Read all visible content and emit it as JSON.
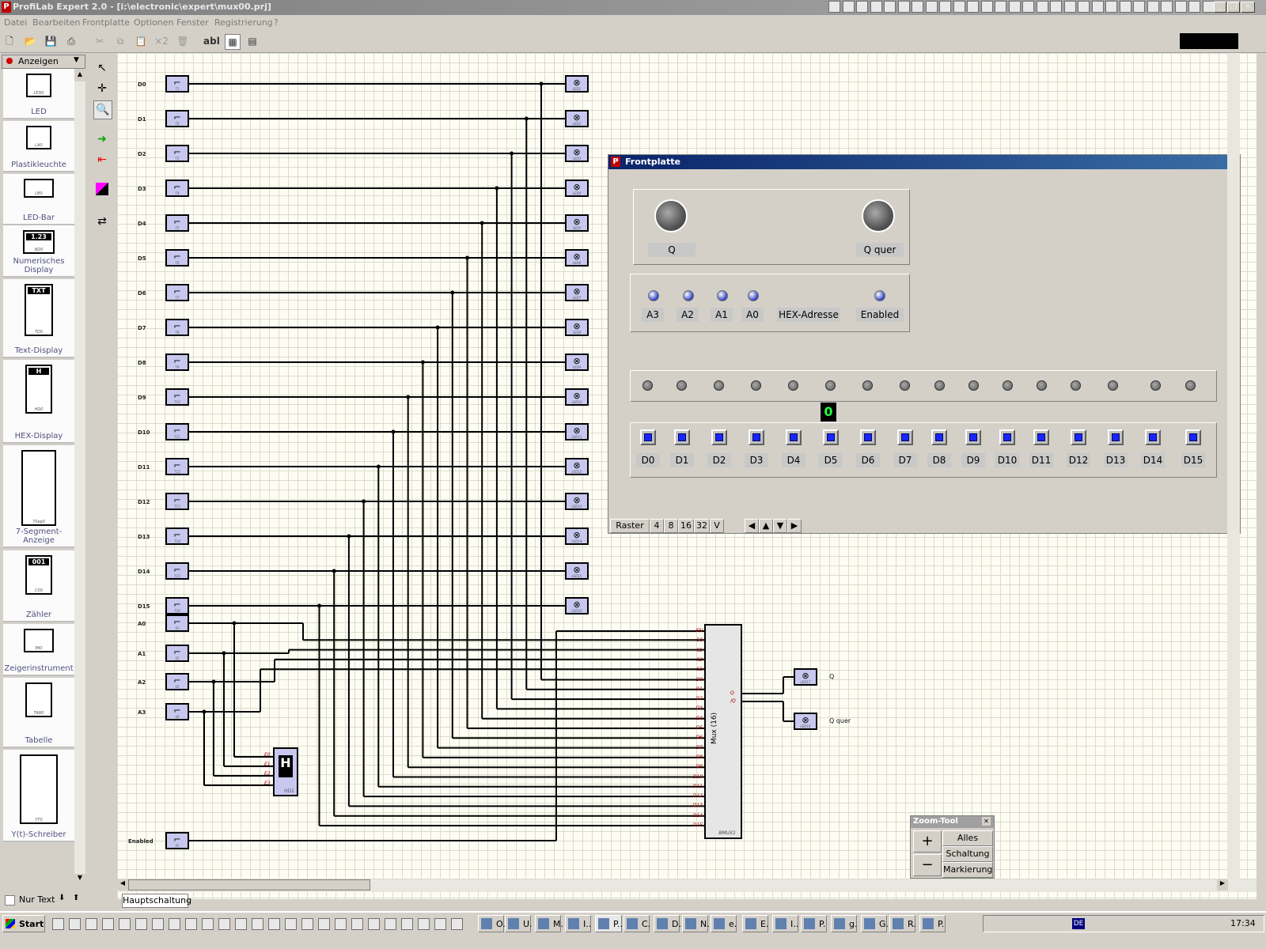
{
  "window": {
    "title": "ProfiLab Expert 2.0 - [i:\\electronic\\expert\\mux00.prj]"
  },
  "menu": [
    "Datei",
    "Bearbeiten",
    "Frontplatte",
    "Optionen",
    "Fenster",
    "Registrierung",
    "?"
  ],
  "toolbar": {
    "x2": "×2",
    "abl": "abl"
  },
  "library": {
    "dropdown": "Anzeigen",
    "nur_text": "Nur Text",
    "items": [
      {
        "label": "LED",
        "tag": "LED0"
      },
      {
        "label": "Plastikleuchte",
        "tag": "LA0"
      },
      {
        "label": "LED-Bar",
        "tag": "LB0"
      },
      {
        "label": "Numerisches Display",
        "tag": "ND0",
        "value": "1.23"
      },
      {
        "label": "Text-Display",
        "tag": "TD0",
        "value": "TXT"
      },
      {
        "label": "HEX-Display",
        "tag": "HD0",
        "value": "H"
      },
      {
        "label": "7-Segment-Anzeige",
        "tag": "7Seg0"
      },
      {
        "label": "Zähler",
        "tag": "C00",
        "value": "001"
      },
      {
        "label": "Zeigerinstrument",
        "tag": "MI0"
      },
      {
        "label": "Tabelle",
        "tag": "TAB0"
      },
      {
        "label": "Y(t)-Schreiber",
        "tag": "YT0"
      }
    ]
  },
  "circuit": {
    "data_rows": [
      "D0",
      "D1",
      "D2",
      "D3",
      "D4",
      "D5",
      "D6",
      "D7",
      "D8",
      "D9",
      "D10",
      "D11",
      "D12",
      "D13",
      "D14",
      "D15"
    ],
    "switch_tags": [
      "T1",
      "T2",
      "T3",
      "T4",
      "T5",
      "T6",
      "T7",
      "T8",
      "T9",
      "T10",
      "T11",
      "T12",
      "T13",
      "T14",
      "T15",
      "T16"
    ],
    "led_tags": [
      "LED1",
      "LED2",
      "LED3",
      "LED4",
      "LED5",
      "LED6",
      "LED7",
      "LED8",
      "LED9",
      "LED10",
      "LED11",
      "LED12",
      "LED13",
      "LED14",
      "LED15",
      "LED16"
    ],
    "addr_rows": [
      "A0",
      "A1",
      "A2",
      "A3"
    ],
    "addr_tags": [
      "S1",
      "S2",
      "S3",
      "S4"
    ],
    "enabled_label": "Enabled",
    "enabled_tag": "S5",
    "mux_label": "Mux (16)",
    "mux_tag": "BMUX1",
    "mux_pins": [
      "EN",
      "S0",
      "S1",
      "S2",
      "S3",
      "D0",
      "D1",
      "D2",
      "D3",
      "D4",
      "D5",
      "D6",
      "D7",
      "D8",
      "D9",
      "D10",
      "D11",
      "D12",
      "D13",
      "D14",
      "D15"
    ],
    "mux_out": [
      "Q",
      "/Q"
    ],
    "hex_tag": "HD1",
    "hex_pins": [
      "E0",
      "E1",
      "E2",
      "E3"
    ],
    "hex_value": "H",
    "out_leds": [
      {
        "tag": "LED17",
        "label": "Q"
      },
      {
        "tag": "LED18",
        "label": "Q quer"
      }
    ]
  },
  "frontplatte": {
    "title": "Frontplatte",
    "knobs": [
      "Q",
      "Q quer"
    ],
    "lamps": [
      "A3",
      "A2",
      "A1",
      "A0"
    ],
    "hex_value": "0",
    "hex_label": "HEX-Adresse",
    "enabled_label": "Enabled",
    "data_buttons": [
      "D0",
      "D1",
      "D2",
      "D3",
      "D4",
      "D5",
      "D6",
      "D7",
      "D8",
      "D9",
      "D10",
      "D11",
      "D12",
      "D13",
      "D14",
      "D15"
    ],
    "raster": {
      "label": "Raster",
      "options": [
        "4",
        "8",
        "16",
        "32",
        "V"
      ]
    }
  },
  "zoomtool": {
    "title": "Zoom-Tool",
    "plus": "+",
    "minus": "−",
    "alles": "Alles",
    "schaltung": "Schaltung",
    "markierung": "Markierung"
  },
  "tabs": {
    "active": "Hauptschaltung"
  },
  "taskbar": {
    "start": "Start",
    "tasks": [
      "O.",
      "U.",
      "M.",
      "I..",
      "P..",
      "C.",
      "D.",
      "N.",
      "e.",
      "E.",
      "I..",
      "P.",
      "g.",
      "G.",
      "R.",
      "P."
    ],
    "lang": "DE",
    "clock": "17:34"
  }
}
